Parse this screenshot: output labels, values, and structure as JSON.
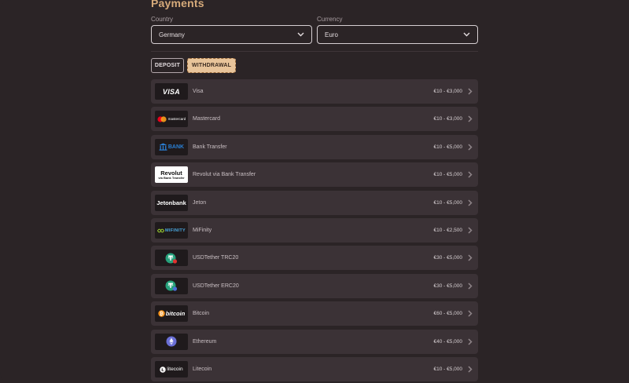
{
  "page": {
    "title": "Payments"
  },
  "country": {
    "label": "Country",
    "value": "Germany"
  },
  "currency": {
    "label": "Currency",
    "value": "Euro"
  },
  "tabs": {
    "deposit": "DEPOSIT",
    "withdrawal": "WITHDRAWAL",
    "active": "withdrawal"
  },
  "colors": {
    "accent": "#d6aa7a",
    "row_bg": "#3b3236",
    "background": "#2b2426"
  },
  "methods": [
    {
      "name": "Visa",
      "range": "€10 - €3,000",
      "logo_text": "VISA",
      "icon": "visa-logo"
    },
    {
      "name": "Mastercard",
      "range": "€10 - €3,000",
      "logo_text": "mastercard",
      "icon": "mastercard-logo"
    },
    {
      "name": "Bank Transfer",
      "range": "€10 - €5,000",
      "logo_text": "BANK",
      "icon": "bank-transfer-logo"
    },
    {
      "name": "Revolut via Bank Transfer",
      "range": "€10 - €5,000",
      "logo_text": "Revolut",
      "logo_sub": "via Bank Transfer",
      "icon": "revolut-logo"
    },
    {
      "name": "Jeton",
      "range": "€10 - €5,000",
      "logo_text": "Jetonbank",
      "icon": "jeton-logo"
    },
    {
      "name": "MiFinity",
      "range": "€10 - €2,500",
      "logo_text": "MIFINITY",
      "icon": "mifinity-logo"
    },
    {
      "name": "USDTether TRC20",
      "range": "€30 - €5,000",
      "icon": "usdt-trc20-logo"
    },
    {
      "name": "USDTether ERC20",
      "range": "€30 - €5,000",
      "icon": "usdt-erc20-logo"
    },
    {
      "name": "Bitcoin",
      "range": "€60 - €5,000",
      "logo_text": "bitcoin",
      "icon": "bitcoin-logo"
    },
    {
      "name": "Ethereum",
      "range": "€40 - €5,000",
      "icon": "ethereum-logo"
    },
    {
      "name": "Litecoin",
      "range": "€10 - €5,000",
      "logo_text": "litecoin",
      "icon": "litecoin-logo"
    }
  ]
}
